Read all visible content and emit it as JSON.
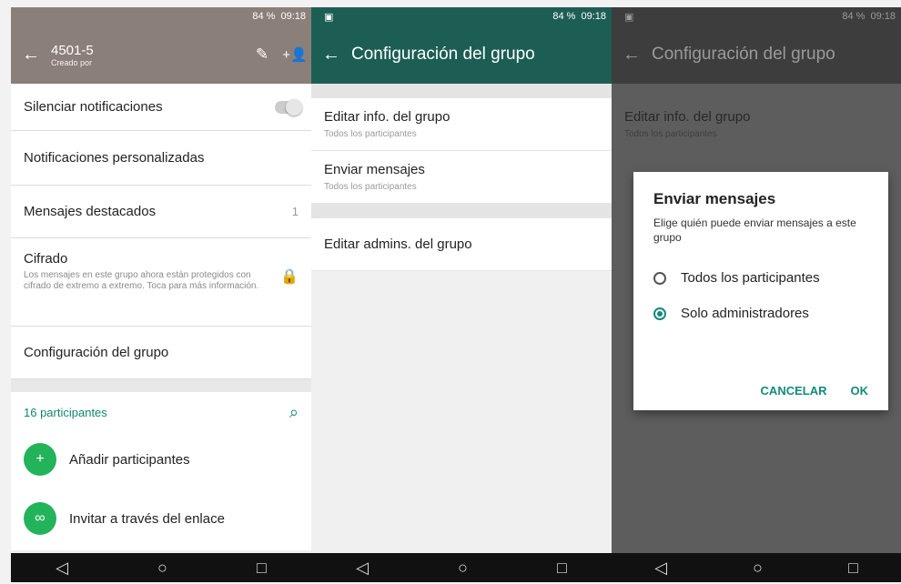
{
  "panel1": {
    "status": {
      "battery": "84 %",
      "time": "09:18"
    },
    "header": {
      "group_name": "4501-5",
      "created_by": "Creado por"
    },
    "rows": [
      {
        "label": "Silenciar notificaciones"
      },
      {
        "label": "Notificaciones personalizadas"
      },
      {
        "label": "Mensajes destacados",
        "value": "1"
      },
      {
        "label": "Cifrado",
        "desc": "Los mensajes en este grupo ahora están protegidos con cifrado de extremo a extremo. Toca para más información."
      },
      {
        "label": "Configuración del grupo"
      }
    ],
    "participants_title": "16 participantes",
    "actions": [
      {
        "label": "Añadir participantes"
      },
      {
        "label": "Invitar a través del enlace"
      }
    ]
  },
  "panel2": {
    "status": {
      "battery": "84 %",
      "time": "09:18"
    },
    "title": "Configuración del grupo",
    "items": [
      {
        "title": "Editar info. del grupo",
        "subtitle": "Todos los participantes"
      },
      {
        "title": "Enviar mensajes",
        "subtitle": "Todos los participantes"
      },
      {
        "title": "Editar admins. del grupo"
      }
    ]
  },
  "panel3": {
    "status": {
      "battery": "84 %",
      "time": "09:18"
    },
    "title": "Configuración del grupo",
    "bg_items": [
      {
        "title": "Editar info. del grupo",
        "subtitle": "Todos los participantes"
      }
    ],
    "dialog": {
      "title": "Enviar mensajes",
      "message": "Elige quién puede enviar mensajes a este grupo",
      "options": [
        "Todos los participantes",
        "Solo administradores"
      ],
      "selected_index": 1,
      "cancel": "CANCELAR",
      "ok": "OK"
    }
  },
  "nav": {
    "back_icon": "◁",
    "home_icon": "○",
    "recents_icon": "□"
  },
  "colors": {
    "panel1_header": "#8b7f7a",
    "panel2_header": "#1c5e54",
    "accent": "#138a7b",
    "green": "#23b35b"
  }
}
